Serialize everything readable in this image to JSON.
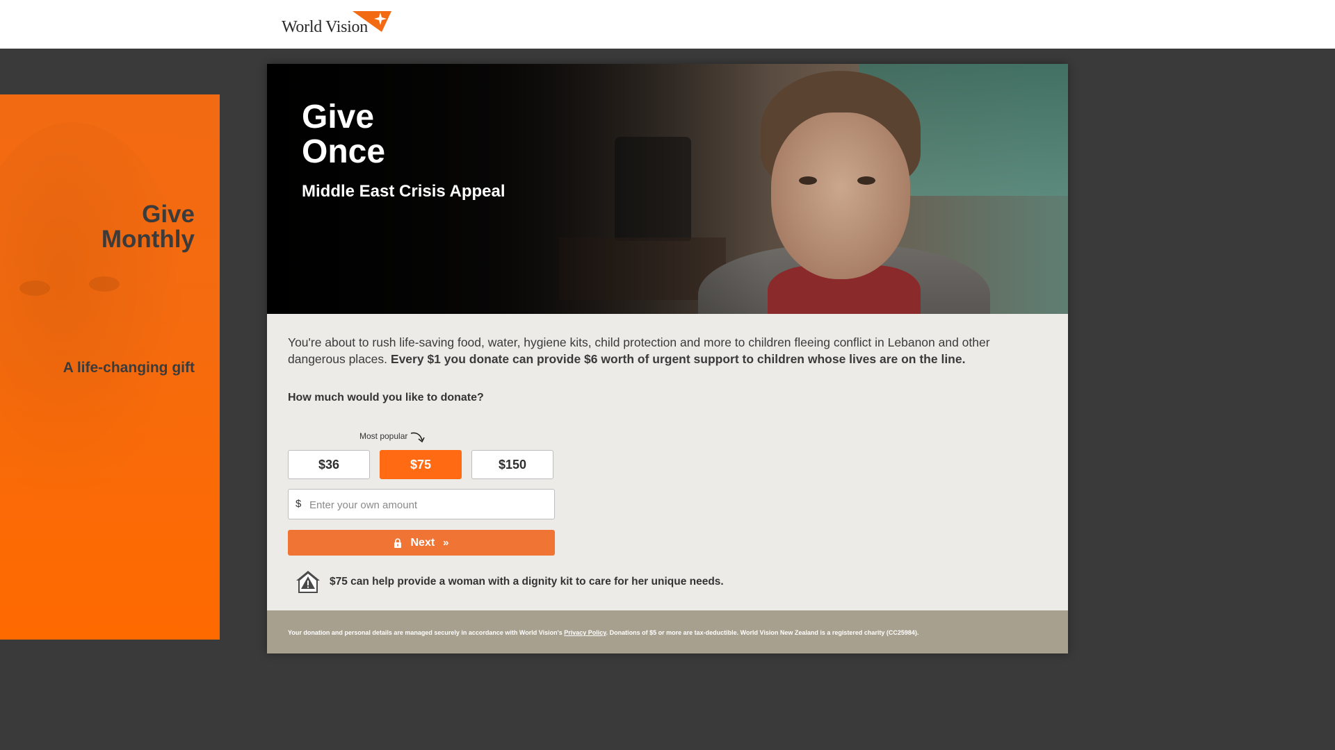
{
  "header": {
    "logo_text": "World Vision",
    "logo_icon": "world-vision-star-icon"
  },
  "side_panel": {
    "title_line1": "Give",
    "title_line2": "Monthly",
    "subtitle": "A life-changing gift"
  },
  "hero": {
    "title_line1": "Give",
    "title_line2": "Once",
    "subtitle": "Middle East Crisis Appeal"
  },
  "intro": {
    "text": "You're about to rush life-saving food, water, hygiene kits, child protection and more to children fleeing conflict in Lebanon and other dangerous places.",
    "bold_text": "Every $1 you donate can provide $6 worth of urgent support to children whose lives are on the line."
  },
  "donation": {
    "question": "How much would you like to donate?",
    "popular_label": "Most popular",
    "amounts": [
      "$36",
      "$75",
      "$150"
    ],
    "selected": "$75",
    "currency_symbol": "$",
    "own_amount_placeholder": "Enter your own amount",
    "own_amount_value": "",
    "next_label": "Next",
    "next_icons": [
      "lock-icon",
      "double-chevron-right-icon"
    ]
  },
  "impact": {
    "icon": "shelter-alert-icon",
    "text": "$75 can help provide a woman with a dignity kit to care for her unique needs."
  },
  "footer": {
    "text_before_link": "Your donation and personal details are managed securely in accordance with World Vision's",
    "link_text": "Privacy Policy",
    "text_after_link": ". Donations of $5 or more are tax-deductible. World Vision New Zealand is a registered charity (CC25984)."
  },
  "colors": {
    "brand_orange": "#ff6a13",
    "button_orange": "#f07535",
    "page_background": "#3a3a3a",
    "card_background": "#edebe8",
    "footer_background": "#a8a08e"
  }
}
